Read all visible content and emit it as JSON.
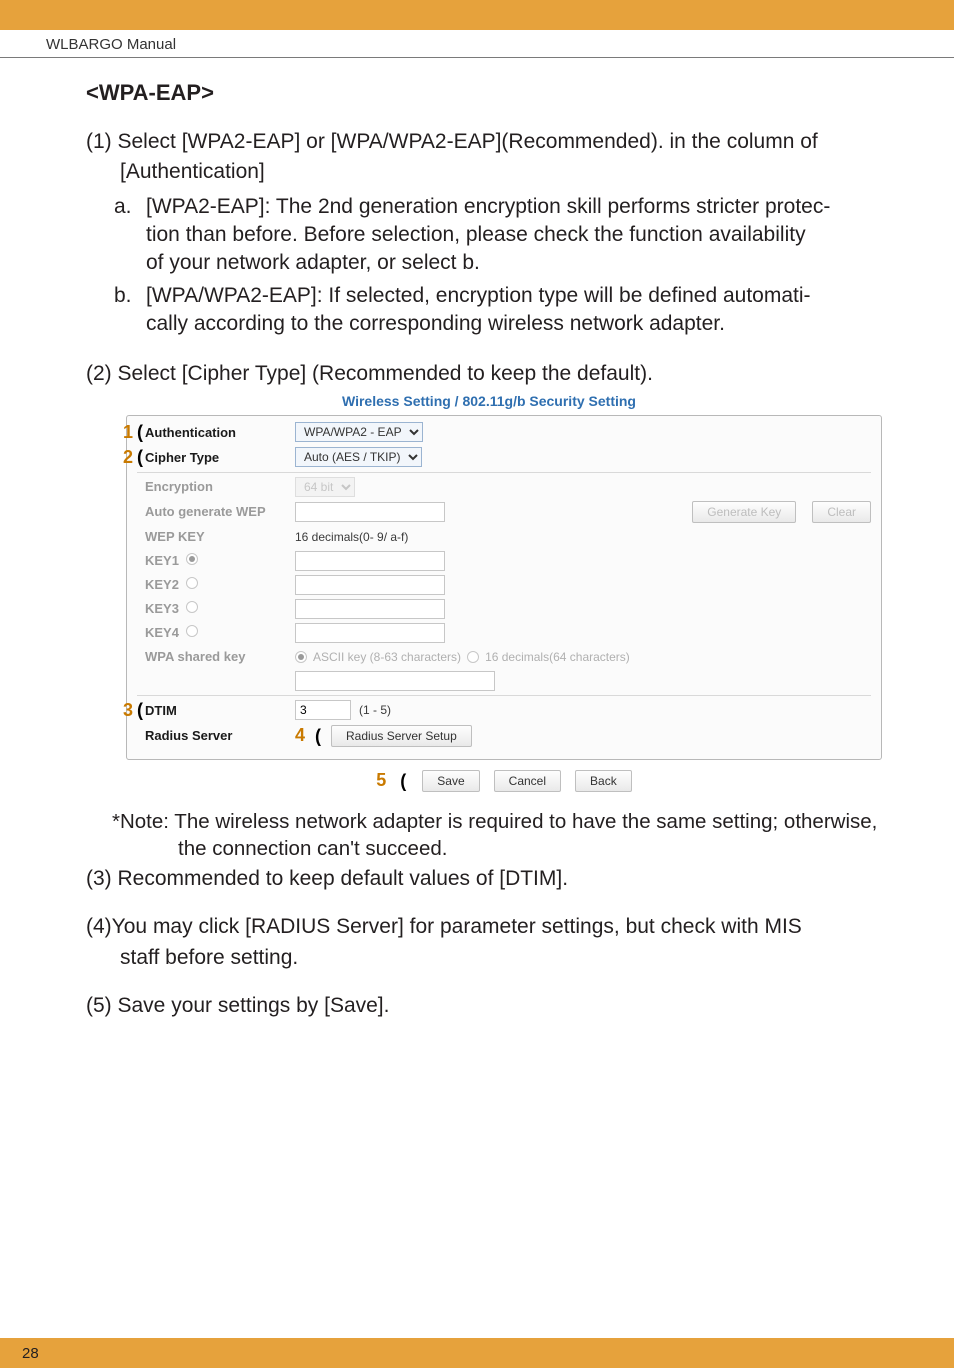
{
  "header": {
    "manual": "WLBARGO Manual"
  },
  "section": {
    "title": "<WPA-EAP>"
  },
  "steps": {
    "s1": {
      "line1": "(1) Select [WPA2-EAP] or [WPA/WPA2-EAP](Recommended). in the column of",
      "line2": "[Authentication]",
      "a": {
        "marker": "a.",
        "l1": "[WPA2-EAP]: The 2nd generation encryption skill performs stricter protec-",
        "l2": "tion than before.  Before selection, please check the function availability",
        "l3": "of your network adapter, or select b."
      },
      "b": {
        "marker": "b.",
        "l1": "[WPA/WPA2-EAP]: If selected, encryption type will be defined automati-",
        "l2": "cally according to the corresponding wireless network adapter."
      }
    },
    "s2": "(2) Select [Cipher Type] (Recommended to keep the default).",
    "s3": "(3) Recommended to keep default values of [DTIM].",
    "s4": {
      "l1": "(4)You may click [RADIUS Server] for parameter settings, but check with MIS",
      "l2": "staff before setting."
    },
    "s5": "(5) Save your settings by [Save]."
  },
  "figure": {
    "title": "Wireless Setting / 802.11g/b Security Setting",
    "rows": {
      "auth": {
        "label": "Authentication",
        "value": "WPA/WPA2 - EAP"
      },
      "cipher": {
        "label": "Cipher Type",
        "value": "Auto (AES / TKIP)"
      },
      "encryption": {
        "label": "Encryption",
        "value": "64 bit"
      },
      "autowep": {
        "label": "Auto generate WEP",
        "btn1": "Generate Key",
        "btn2": "Clear"
      },
      "wepkey": {
        "label": "WEP KEY",
        "hint": "16 decimals(0- 9/ a-f)"
      },
      "key1": {
        "label": "KEY1"
      },
      "key2": {
        "label": "KEY2"
      },
      "key3": {
        "label": "KEY3"
      },
      "key4": {
        "label": "KEY4"
      },
      "wpashared": {
        "label": "WPA shared key",
        "opt1": "ASCII key (8-63 characters)",
        "opt2": "16 decimals(64 characters)"
      },
      "dtim": {
        "label": "DTIM",
        "value": "3",
        "range": "(1 - 5)"
      },
      "radius": {
        "label": "Radius Server",
        "btn": "Radius Server Setup"
      }
    },
    "buttons": {
      "save": "Save",
      "cancel": "Cancel",
      "back": "Back"
    }
  },
  "note": {
    "l1": "*Note: The wireless network adapter is required to have the same setting; otherwise,",
    "l2": "the connection can't succeed."
  },
  "footer": {
    "page": "28"
  }
}
